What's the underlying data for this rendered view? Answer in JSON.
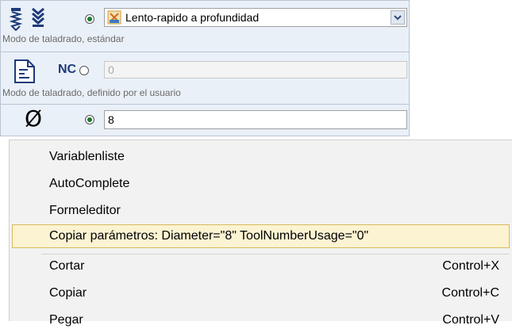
{
  "panel": {
    "row1": {
      "combo_value": "Lento-rapido a profundidad",
      "caption": "Modo de taladrado, estándar"
    },
    "row2": {
      "nc_label": "NC",
      "field_value": "0",
      "caption": "Modo de taladrado, definido por el usuario"
    },
    "row3": {
      "diameter_symbol": "Ø",
      "field_value": "8"
    }
  },
  "context_menu": {
    "items": [
      {
        "label": "Variablenliste",
        "shortcut": ""
      },
      {
        "label": "AutoComplete",
        "shortcut": ""
      },
      {
        "label": "Formeleditor",
        "shortcut": ""
      },
      {
        "label": "Copiar parámetros: Diameter=\"8\" ToolNumberUsage=\"0\"",
        "shortcut": ""
      },
      {
        "label": "Cortar",
        "shortcut": "Control+X"
      },
      {
        "label": "Copiar",
        "shortcut": "Control+C"
      },
      {
        "label": "Pegar",
        "shortcut": "Control+V"
      }
    ],
    "highlighted_index": 3
  },
  "colors": {
    "panel_bg": "#eaf0f7",
    "menu_bg": "#f2f2f2",
    "highlight_bg": "#fcf3d2",
    "highlight_border": "#d9b95a",
    "radio_green": "#1e7a2e"
  },
  "icons": [
    "drill-icon",
    "deep-drill-icon",
    "tool-combo-icon",
    "nc-document-icon",
    "diameter-icon",
    "dropdown-arrow-icon"
  ]
}
